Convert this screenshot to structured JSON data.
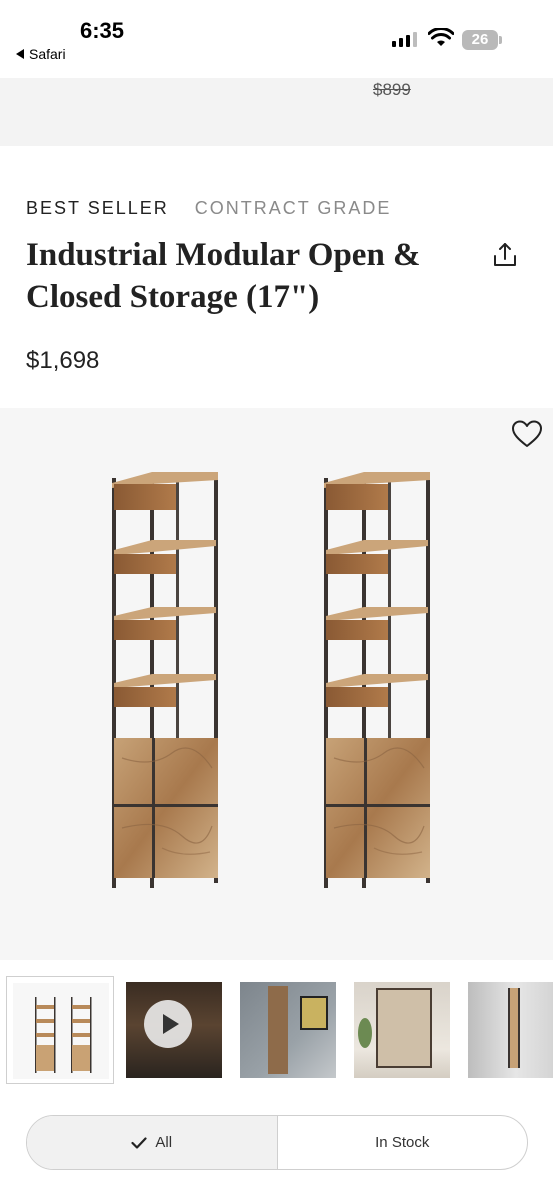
{
  "status_bar": {
    "time": "6:35",
    "back_label": "Safari",
    "battery": "26"
  },
  "sticky": {
    "old_price": "$899"
  },
  "product": {
    "badges": [
      "BEST SELLER",
      "CONTRACT GRADE"
    ],
    "title": "Industrial Modular Open & Closed Storage (17\")",
    "price": "$1,698"
  },
  "icons": {
    "share": "share-icon",
    "favorite": "heart-icon",
    "play": "play-icon",
    "check": "checkmark-icon"
  },
  "gallery": {
    "thumbnails": [
      "front",
      "video",
      "room-office",
      "room-living",
      "angle"
    ]
  },
  "filter": {
    "all_label": "All",
    "in_stock_label": "In Stock"
  }
}
